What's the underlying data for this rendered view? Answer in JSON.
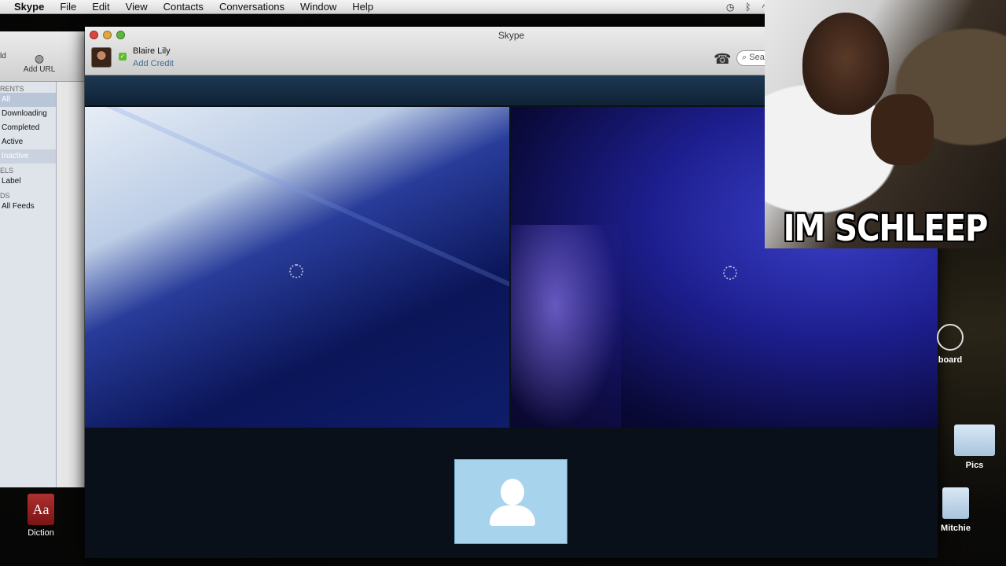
{
  "menubar": {
    "app": "Skype",
    "items": [
      "File",
      "Edit",
      "View",
      "Contacts",
      "Conversations",
      "Window",
      "Help"
    ]
  },
  "bg_app": {
    "toolbar_left": "ld",
    "toolbar_add_url": "Add URL",
    "section_torrents": "RENTS",
    "filters": [
      "All",
      "Downloading",
      "Completed",
      "Active",
      "Inactive"
    ],
    "section_labels": "ELS",
    "label_item": "Label",
    "section_feeds": "DS",
    "feeds_item": "All Feeds"
  },
  "desktop_left": {
    "dictionary_label": "Diction",
    "dictionary_glyph": "Aa"
  },
  "skype": {
    "window_title": "Skype",
    "contact_name": "Blaire Lily",
    "add_credit": "Add Credit",
    "search_placeholder": "Sea",
    "status_check": "✓"
  },
  "meme": {
    "caption": "IM SCHLEEP"
  },
  "desktop_right": {
    "dashboard_label": "board",
    "pics_label": "Pics",
    "mitchie_label": "Mitchie"
  },
  "colors": {
    "skype_status": "#5cbd2c",
    "self_view_bg": "#a7d3ec",
    "close": "#e0443e",
    "minimize": "#e1a73e",
    "zoom": "#5cb83a"
  },
  "icons": [
    "apple-icon",
    "time-machine-icon",
    "bluetooth-icon",
    "wifi-icon",
    "phone-icon",
    "search-icon",
    "default-avatar-icon",
    "loading-spinner-icon",
    "folder-icon",
    "dashboard-icon",
    "dictionary-icon"
  ]
}
